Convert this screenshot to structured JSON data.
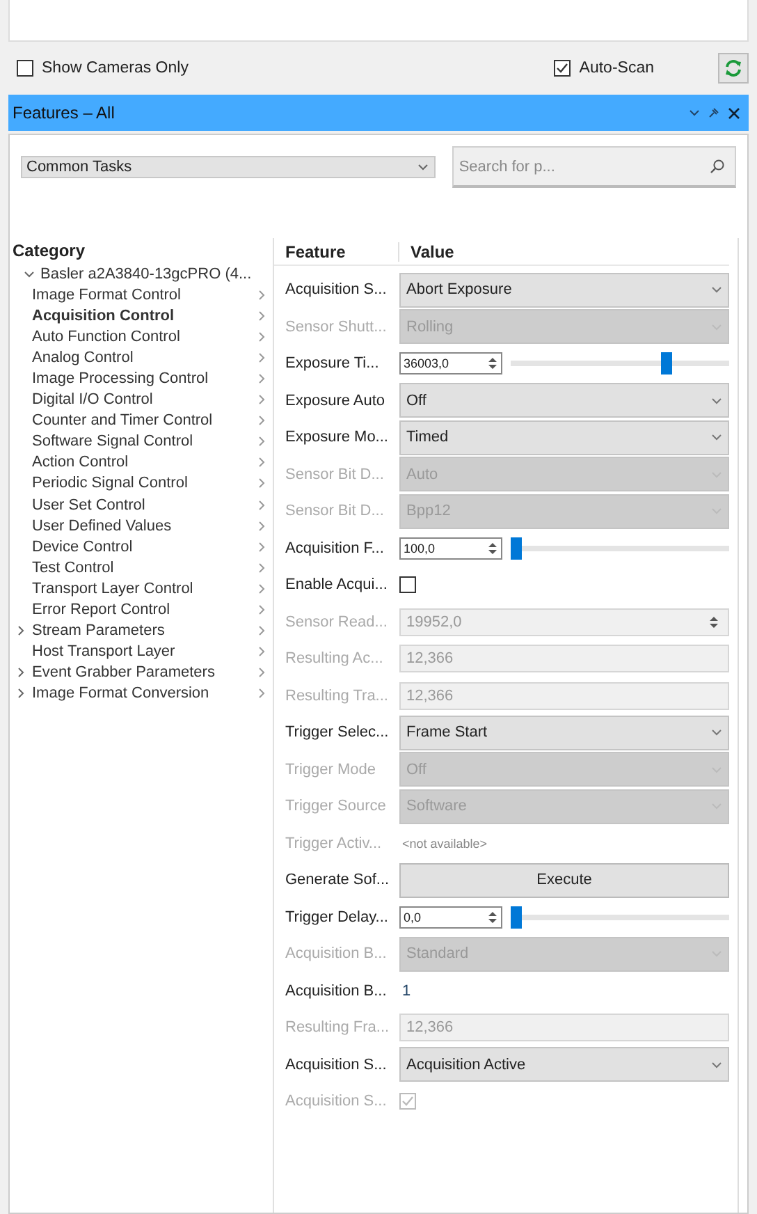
{
  "toolbar": {
    "show_cameras_only": {
      "label": "Show Cameras Only",
      "checked": false
    },
    "auto_scan": {
      "label": "Auto-Scan",
      "checked": true
    }
  },
  "panel": {
    "title": "Features – All"
  },
  "filter": {
    "value": "Common Tasks"
  },
  "search": {
    "placeholder": "Search for p..."
  },
  "category": {
    "heading": "Category",
    "tree": [
      {
        "label": "Basler a2A3840-13gcPRO (4...",
        "kind": "folder",
        "expanded": true,
        "children": [
          {
            "label": "Image Format Control",
            "kind": "leaf",
            "selected": false
          },
          {
            "label": "Acquisition Control",
            "kind": "leaf",
            "selected": true
          },
          {
            "label": "Auto Function Control",
            "kind": "leaf",
            "selected": false
          },
          {
            "label": "Analog Control",
            "kind": "leaf",
            "selected": false
          },
          {
            "label": "Image Processing Control",
            "kind": "leaf",
            "selected": false
          },
          {
            "label": "Digital I/O Control",
            "kind": "leaf",
            "selected": false
          },
          {
            "label": "Counter and Timer Control",
            "kind": "leaf",
            "selected": false
          },
          {
            "label": "Software Signal Control",
            "kind": "leaf",
            "selected": false
          },
          {
            "label": "Action Control",
            "kind": "leaf",
            "selected": false
          },
          {
            "label": "Periodic Signal Control",
            "kind": "leaf",
            "selected": false
          },
          {
            "label": "User Set Control",
            "kind": "leaf",
            "selected": false
          },
          {
            "label": "User Defined Values",
            "kind": "leaf",
            "selected": false
          },
          {
            "label": "Device Control",
            "kind": "leaf",
            "selected": false
          },
          {
            "label": "Test Control",
            "kind": "leaf",
            "selected": false
          },
          {
            "label": "Transport Layer Control",
            "kind": "leaf",
            "selected": false
          },
          {
            "label": "Error Report Control",
            "kind": "leaf",
            "selected": false
          },
          {
            "label": "Stream Parameters",
            "kind": "folder",
            "expanded": false,
            "selected": false
          },
          {
            "label": "Host Transport Layer",
            "kind": "leaf",
            "selected": false
          },
          {
            "label": "Event Grabber Parameters",
            "kind": "folder",
            "expanded": false,
            "selected": false
          },
          {
            "label": "Image Format Conversion",
            "kind": "folder",
            "expanded": false,
            "selected": false
          }
        ]
      }
    ]
  },
  "features": {
    "columns": [
      "Feature",
      "Value"
    ],
    "rows": [
      {
        "name": "Acquisition S...",
        "kind": "dropdown",
        "disabled": false,
        "value": "Abort Exposure"
      },
      {
        "name": "Sensor Shutt...",
        "kind": "dropdown",
        "disabled": true,
        "value": "Rolling"
      },
      {
        "name": "Exposure Ti...",
        "kind": "slider",
        "disabled": false,
        "value": "36003,0",
        "level": 0.69
      },
      {
        "name": "Exposure Auto",
        "kind": "dropdown",
        "disabled": false,
        "value": "Off"
      },
      {
        "name": "Exposure Mo...",
        "kind": "dropdown",
        "disabled": false,
        "value": "Timed"
      },
      {
        "name": "Sensor Bit D...",
        "kind": "dropdown",
        "disabled": true,
        "value": "Auto"
      },
      {
        "name": "Sensor Bit D...",
        "kind": "dropdown",
        "disabled": true,
        "value": "Bpp12"
      },
      {
        "name": "Acquisition F...",
        "kind": "slider",
        "disabled": false,
        "value": "100,0",
        "level": 0.0
      },
      {
        "name": "Enable Acqui...",
        "kind": "checkbox",
        "disabled": false,
        "checked": false
      },
      {
        "name": "Sensor Read...",
        "kind": "spin",
        "disabled": true,
        "value": "19952,0"
      },
      {
        "name": "Resulting Ac...",
        "kind": "field",
        "disabled": true,
        "value": "12,366"
      },
      {
        "name": "Resulting Tra...",
        "kind": "field",
        "disabled": true,
        "value": "12,366"
      },
      {
        "name": "Trigger Selec...",
        "kind": "dropdown",
        "disabled": false,
        "value": "Frame Start"
      },
      {
        "name": "Trigger Mode",
        "kind": "dropdown",
        "disabled": true,
        "value": "Off"
      },
      {
        "name": "Trigger Source",
        "kind": "dropdown",
        "disabled": true,
        "value": "Software"
      },
      {
        "name": "Trigger Activ...",
        "kind": "note",
        "disabled": true,
        "value": "<not available>"
      },
      {
        "name": "Generate Sof...",
        "kind": "button",
        "disabled": false,
        "value": "Execute"
      },
      {
        "name": "Trigger Delay...",
        "kind": "slider",
        "disabled": false,
        "value": "0,0",
        "level": 0.0
      },
      {
        "name": "Acquisition B...",
        "kind": "dropdown",
        "disabled": true,
        "value": "Standard"
      },
      {
        "name": "Acquisition B...",
        "kind": "text",
        "disabled": false,
        "value": "1"
      },
      {
        "name": "Resulting Fra...",
        "kind": "field",
        "disabled": true,
        "value": "12,366"
      },
      {
        "name": "Acquisition S...",
        "kind": "dropdown",
        "disabled": false,
        "value": "Acquisition Active"
      },
      {
        "name": "Acquisition S...",
        "kind": "checkbox",
        "disabled": true,
        "checked": true
      }
    ]
  }
}
